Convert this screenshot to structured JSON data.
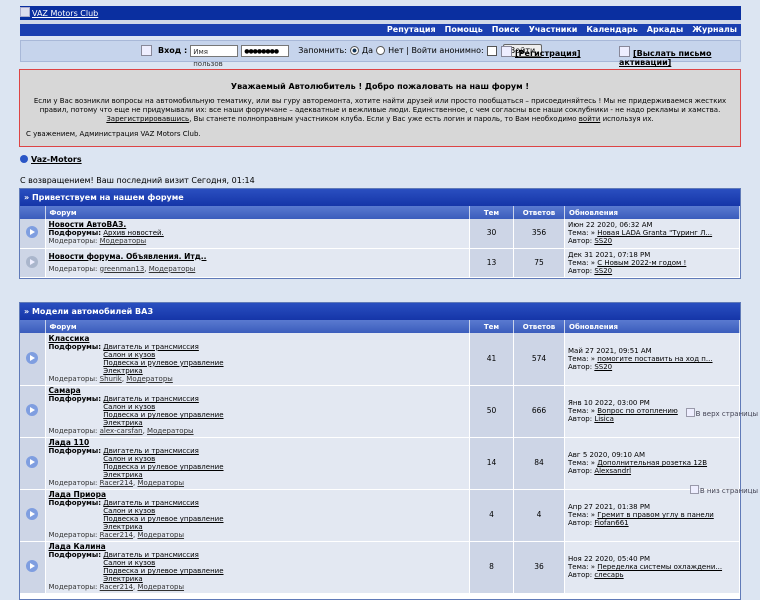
{
  "logo": {
    "alt": "VAZ Motors Club"
  },
  "nav": [
    "Репутация",
    "Помощь",
    "Поиск",
    "Участники",
    "Календарь",
    "Аркады",
    "Журналы"
  ],
  "login": {
    "label": "Вход :",
    "username_placeholder": "Имя пользов",
    "password_value": "●●●●●●●●",
    "remember_label": "Запомнить:",
    "yes_label": "Да",
    "no_label": "Нет | Войти анонимно:",
    "submit_label": "Войти",
    "register_label": "[Регистрация]",
    "activation_label": "[Выслать письмо активации]"
  },
  "welcome": {
    "heading": "Уважаемый Автолюбитель ! Добро пожаловать на наш форум !",
    "p1a": "Если у Вас возникли вопросы на автомобильную тематику, или вы гуру авторемонта, хотите найти друзей или просто пообщаться – присоединяйтесь ! Мы не придерживаемся жестких правил, потому что еще не придумывали их: все наши форумчане – адекватные и вежливые люди. Единственное, с чем согласны все наши соклубники - не надо рекламы и хамства.",
    "p1_link": "Зарегистрировавшись",
    "p1b": ", Вы станете полноправным участником клуба. Если у Вас уже есть логин и пароль, то Вам необходимо",
    "p1_link2": "войти",
    "p1c": "используя их.",
    "signature": "С уважением, Администрация VAZ Motors Club."
  },
  "breadcrumb": "Vaz-Motors",
  "last_visit": "С возвращением! Ваш последний визит Сегодня, 01:14",
  "headers": {
    "forum": "Форум",
    "topics": "Тем",
    "replies": "Ответов",
    "updates": "Обновления"
  },
  "labels": {
    "subforums": "Подфорумы:",
    "moderators": "Модераторы:",
    "topic": "Тема:",
    "author": "Автор:"
  },
  "side_links": {
    "to_top": "В верх страницы",
    "to_bottom": "В низ страницы"
  },
  "categories": [
    {
      "title": "Приветствуем на нашем форуме",
      "forums": [
        {
          "name": "Новости АвтоВАЗ.",
          "subforums": "Архив новостей.",
          "moderators": [
            "Модераторы"
          ],
          "topics": "30",
          "replies": "356",
          "date": "Июн 22 2020, 06:32 AM",
          "topic": "Новая LADA Granta \"Туринг Л...",
          "author": "SS20",
          "read": false
        },
        {
          "name": "Новости форума. Объявления. Итд..",
          "subforums": "",
          "moderators": [
            "greenman13",
            "Модераторы"
          ],
          "topics": "13",
          "replies": "75",
          "date": "Дек 31 2021, 07:18 PM",
          "topic": "С Новым 2022-м годом !",
          "author": "SS20",
          "read": true
        }
      ]
    },
    {
      "title": "Модели автомобилей ВАЗ",
      "forums": [
        {
          "name": "Классика",
          "subs": [
            "Двигатель и трансмиссия",
            "Салон и кузов",
            "Подвеска и рулевое управление",
            "Электрика"
          ],
          "moderators": [
            "Shurik",
            "Модераторы"
          ],
          "topics": "41",
          "replies": "574",
          "date": "Май 27 2021, 09:51 AM",
          "topic": "помогите поставить на ход п...",
          "author": "SS20"
        },
        {
          "name": "Самара",
          "subs": [
            "Двигатель и трансмиссия",
            "Салон и кузов",
            "Подвеска и рулевое управление",
            "Электрика"
          ],
          "moderators": [
            "alex-carsfan",
            "Модераторы"
          ],
          "topics": "50",
          "replies": "666",
          "date": "Янв 10 2022, 03:00 PM",
          "topic": "Вопрос по отоплению",
          "author": "Lisica"
        },
        {
          "name": "Лада 110",
          "subs": [
            "Двигатель и трансмиссия",
            "Салон и кузов",
            "Подвеска и рулевое управление",
            "Электрика"
          ],
          "moderators": [
            "Racer214",
            "Модераторы"
          ],
          "topics": "14",
          "replies": "84",
          "date": "Авг 5 2020, 09:10 AM",
          "topic": "Дополнительная розетка 12В",
          "author": "Alexsandrl"
        },
        {
          "name": "Лада Приора",
          "subs": [
            "Двигатель и трансмиссия",
            "Салон и кузов",
            "Подвеска и рулевое управление",
            "Электрика"
          ],
          "moderators": [
            "Racer214",
            "Модераторы"
          ],
          "topics": "4",
          "replies": "4",
          "date": "Апр 27 2021, 01:38 PM",
          "topic": "Гремит в правом углу в панели",
          "author": "Fiofan661"
        },
        {
          "name": "Лада Калина",
          "subs": [
            "Двигатель и трансмиссия",
            "Салон и кузов",
            "Подвеска и рулевое управление",
            "Электрика"
          ],
          "moderators": [
            "Racer214",
            "Модераторы"
          ],
          "topics": "8",
          "replies": "36",
          "date": "Ноя 22 2020, 05:40 PM",
          "topic": "Переделка системы охлаждени...",
          "author": "слесарь"
        }
      ]
    }
  ]
}
